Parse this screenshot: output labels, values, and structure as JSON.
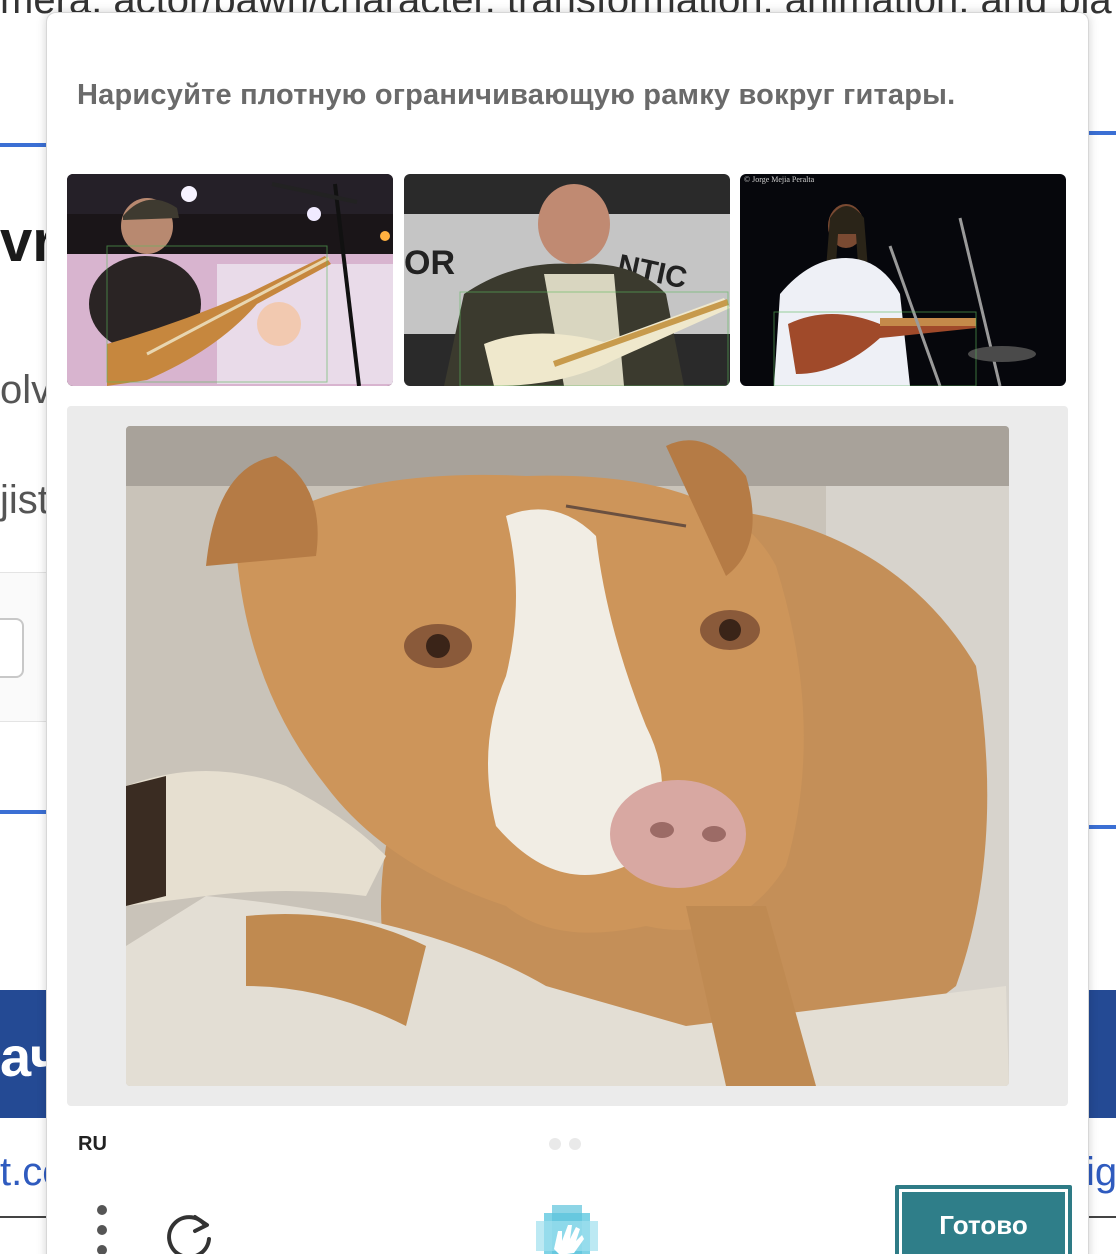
{
  "background_page": {
    "top_text": "mera, actor/pawn/character, transformation, animation, and pla",
    "big_fragment": "vr",
    "fragment_olv": "olv",
    "fragment_jist": "jist",
    "bar_fragment": "ач",
    "link_fragment_left": "t.co",
    "link_fragment_right": "ig",
    "accent_color": "#3b6fd4",
    "bar_color": "#244a94"
  },
  "captcha": {
    "prompt": "Нарисуйте плотную ограничивающую рамку вокруг гитары.",
    "example_images": [
      {
        "subject": "bassist-on-stage-photo",
        "alt": "example guitar 1"
      },
      {
        "subject": "guitarist-white-strat-photo",
        "alt": "example guitar 2"
      },
      {
        "subject": "dreadlock-guitarist-photo",
        "alt": "example guitar 3",
        "watermark": "© Jorge Mejia Peralta"
      }
    ],
    "task_image": {
      "subject": "pit-bull-dog-photo"
    },
    "language": "RU",
    "page_indicator": {
      "count": 2,
      "active": 0
    },
    "menu_icon": "kebab-menu-icon",
    "refresh_icon": "refresh-icon",
    "logo_icon": "hcaptcha-hand-icon",
    "submit_label": "Готово",
    "colors": {
      "prompt_text": "#6a6a6a",
      "submit_bg": "#2f7e89",
      "image_frame": "#ebebeb"
    }
  }
}
